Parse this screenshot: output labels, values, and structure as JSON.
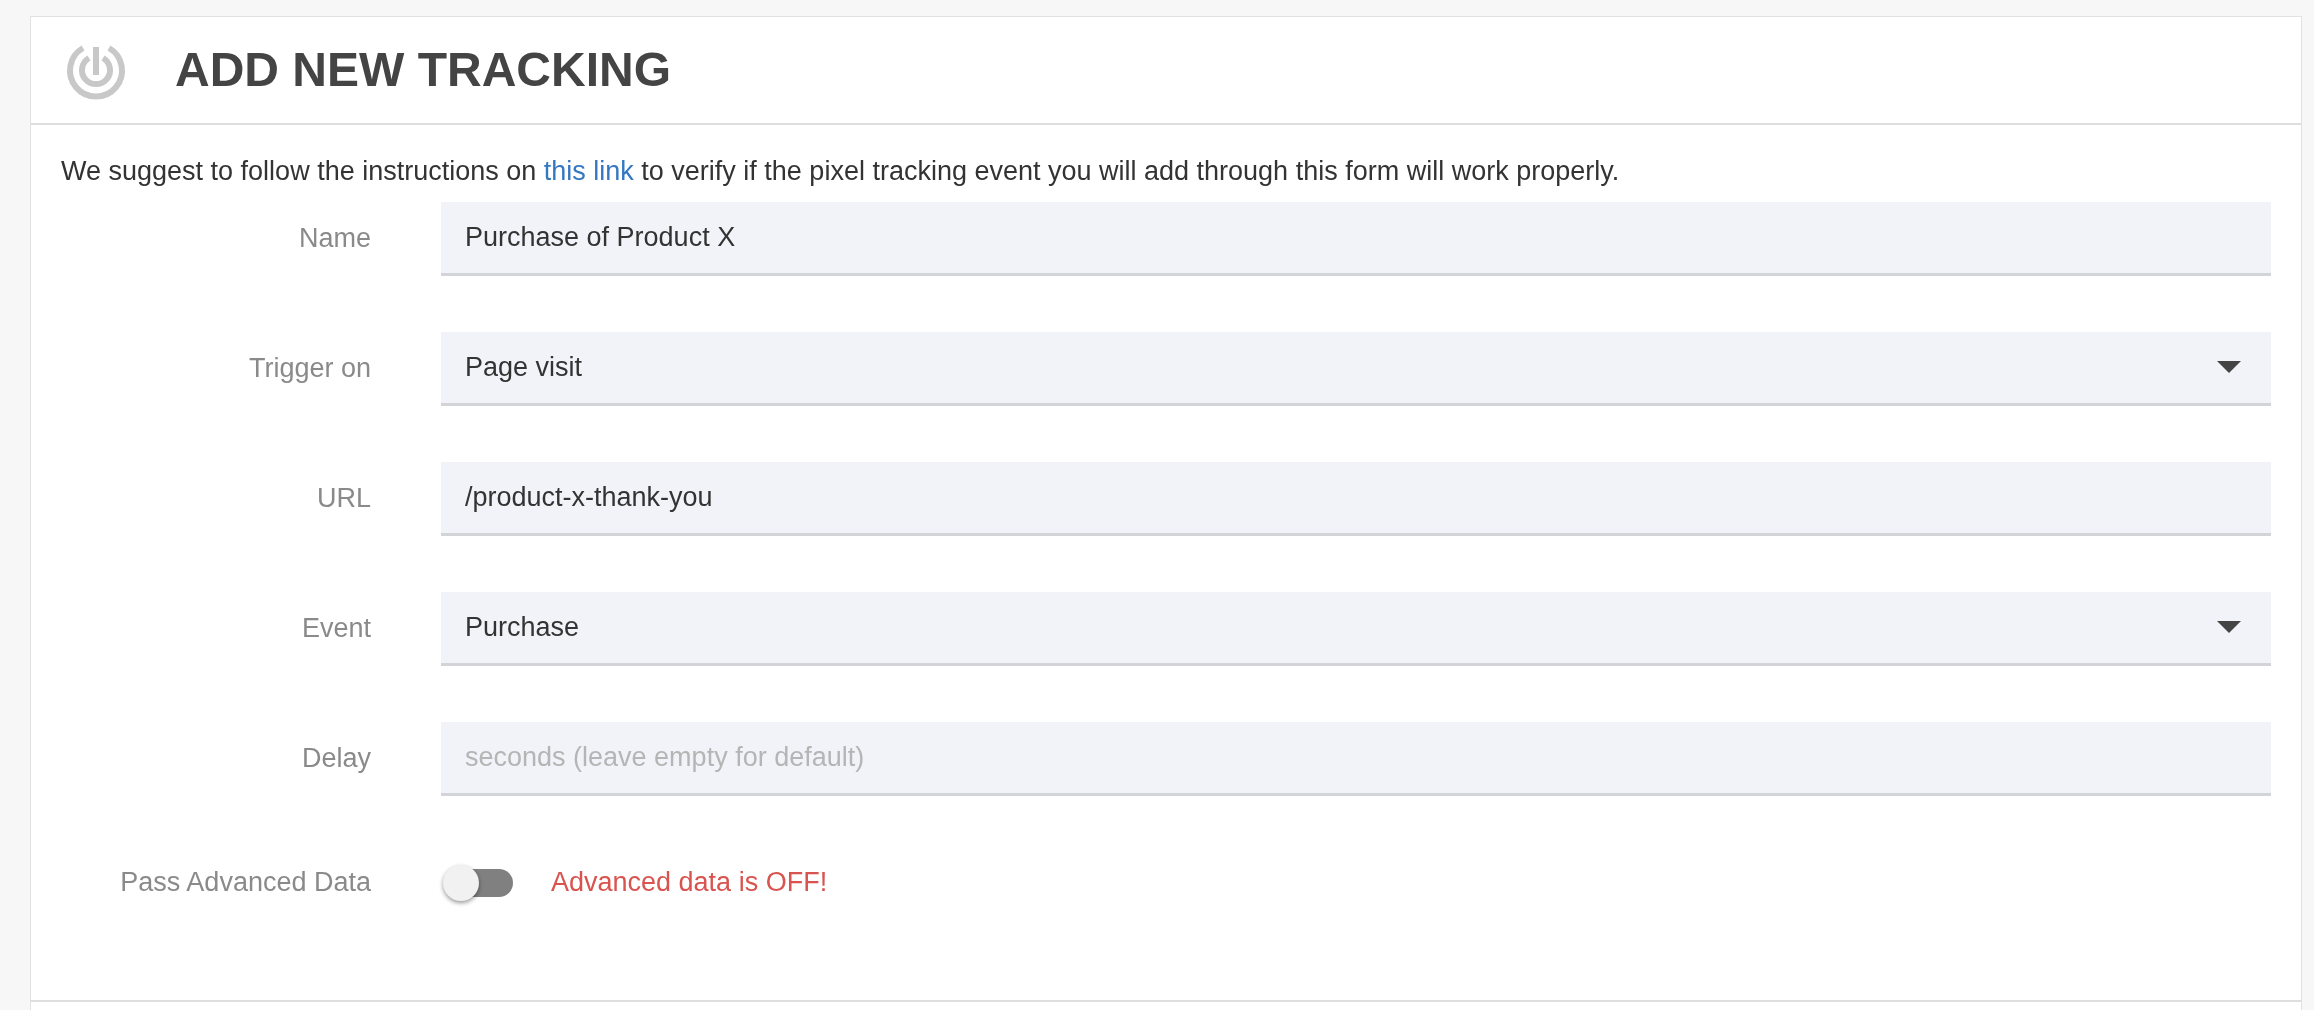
{
  "header": {
    "title": "ADD NEW TRACKING"
  },
  "intro": {
    "before": "We suggest to follow the instructions on ",
    "link": "this link",
    "after": " to verify if the pixel tracking event you will add through this form will work properly."
  },
  "fields": [
    {
      "label": "Name",
      "kind": "text",
      "value": "Purchase of Product X"
    },
    {
      "label": "Trigger on",
      "kind": "select",
      "value": "Page visit"
    },
    {
      "label": "URL",
      "kind": "text",
      "value": "/product-x-thank-you"
    },
    {
      "label": "Event",
      "kind": "select",
      "value": "Purchase"
    },
    {
      "label": "Delay",
      "kind": "text",
      "placeholder": "seconds (leave empty for default)"
    }
  ],
  "advanced": {
    "label": "Pass Advanced Data",
    "on": false,
    "message": "Advanced data is OFF!"
  }
}
